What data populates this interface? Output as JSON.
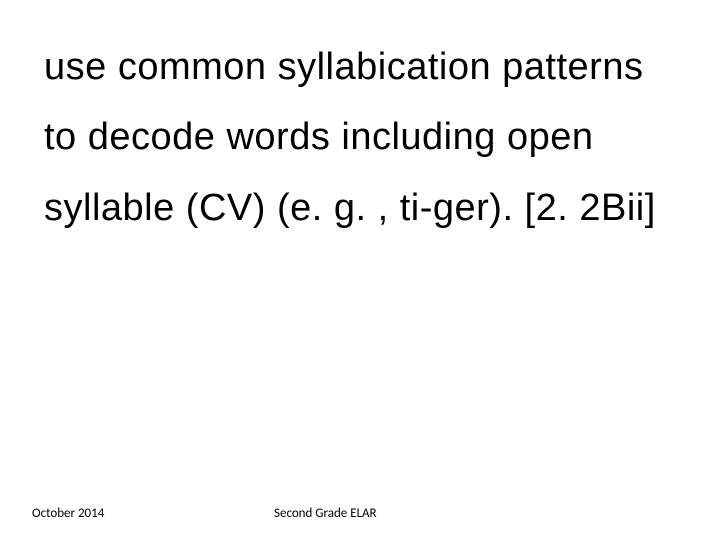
{
  "body": {
    "text": "use common syllabication patterns to decode words including open syllable (CV) (e. g. , ti-ger). [2. 2Bii]"
  },
  "footer": {
    "date": "October 2014",
    "label": "Second Grade ELAR"
  }
}
